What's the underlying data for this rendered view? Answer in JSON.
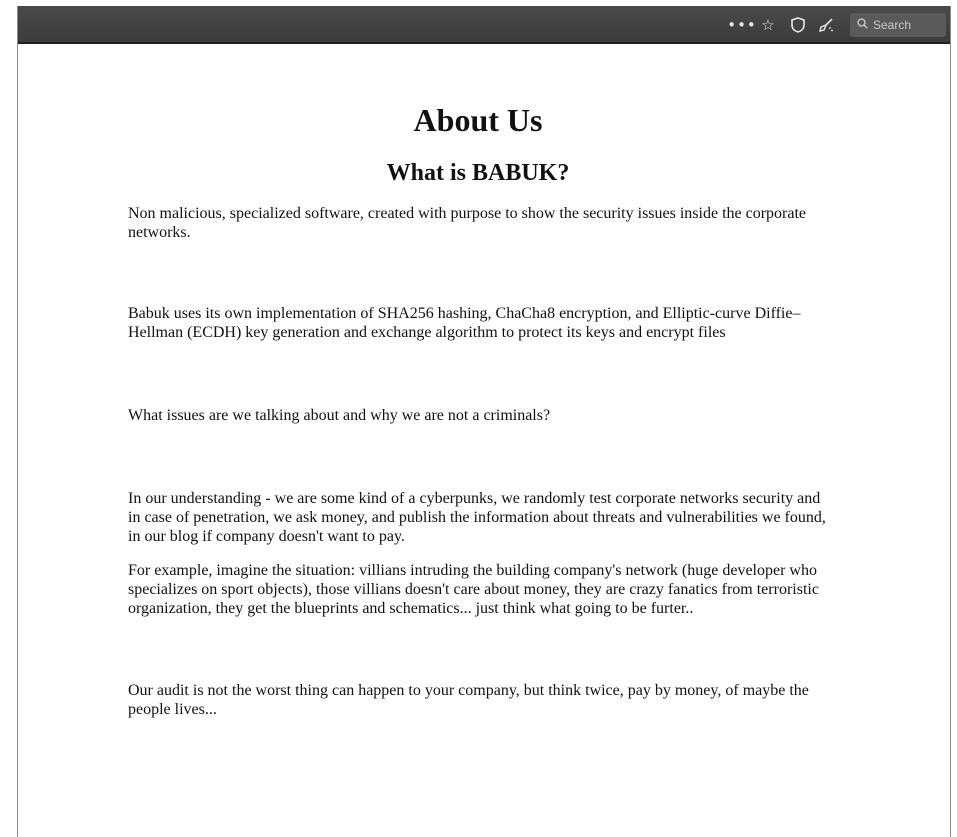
{
  "browser": {
    "toolbar": {
      "more_icon": "•••",
      "star_icon": "☆",
      "shield_icon": "shield",
      "broom_icon": "broom",
      "search_placeholder": "Search"
    }
  },
  "page": {
    "title": "About Us",
    "subtitle": "What is BABUK?",
    "paragraphs": [
      "Non malicious, specialized software, created with purpose to show the security issues inside the corporate networks.",
      "Babuk uses its own implementation of SHA256 hashing, ChaCha8 encryption, and Elliptic-curve Diffie–Hellman (ECDH) key generation and exchange algorithm to protect its keys and encrypt files",
      "What issues are we talking about and why we are not a criminals?",
      "In our understanding - we are some kind of a cyberpunks, we randomly test corporate networks security and in case of penetration, we ask money, and publish the information about threats and vulnerabilities we found, in our blog if company doesn't want to pay.",
      "For example, imagine the situation: villians intruding the building company's network (huge developer who specializes on sport objects), those villians doesn't care about money, they are crazy fanatics from terroristic organization, they get the blueprints and schematics... just think what going to be furter..",
      "Our audit is not the worst thing can happen to your company, but think twice, pay by money, of maybe the people lives..."
    ]
  }
}
